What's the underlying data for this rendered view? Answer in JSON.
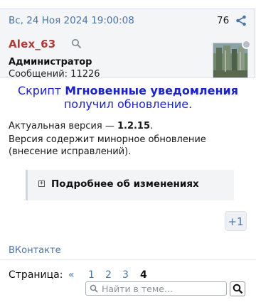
{
  "post": {
    "date": "Вс, 24 Ноя 2024 19:00:08",
    "number": "76",
    "author": {
      "name": "Alex_63",
      "role": "Администратор",
      "posts_label": "Сообщений:",
      "posts_count": "11226"
    }
  },
  "body": {
    "announce_prefix": "Скрипт ",
    "announce_script_name": "Мгновенные уведомления",
    "announce_suffix": "получил обновление.",
    "version_prefix": "Актуальная версия — ",
    "version_number": "1.2.15",
    "version_suffix": ".",
    "version_desc": "Версия содержит минорное обновление (внесение исправлений).",
    "spoiler_toggle": "+",
    "spoiler_title": "Подробнее об изменениях",
    "reaction_label": "+1",
    "share_link": "ВКонтакте"
  },
  "pager": {
    "label": "Страница:",
    "prev": "«",
    "pages": [
      "1",
      "2",
      "3",
      "4"
    ],
    "current": "4"
  },
  "search": {
    "placeholder": "Найти в теме..."
  },
  "colors": {
    "username": "#b03a3a",
    "link": "#4b73a3",
    "announce": "#1c22c9",
    "header_bg": "#f4f5f7"
  }
}
